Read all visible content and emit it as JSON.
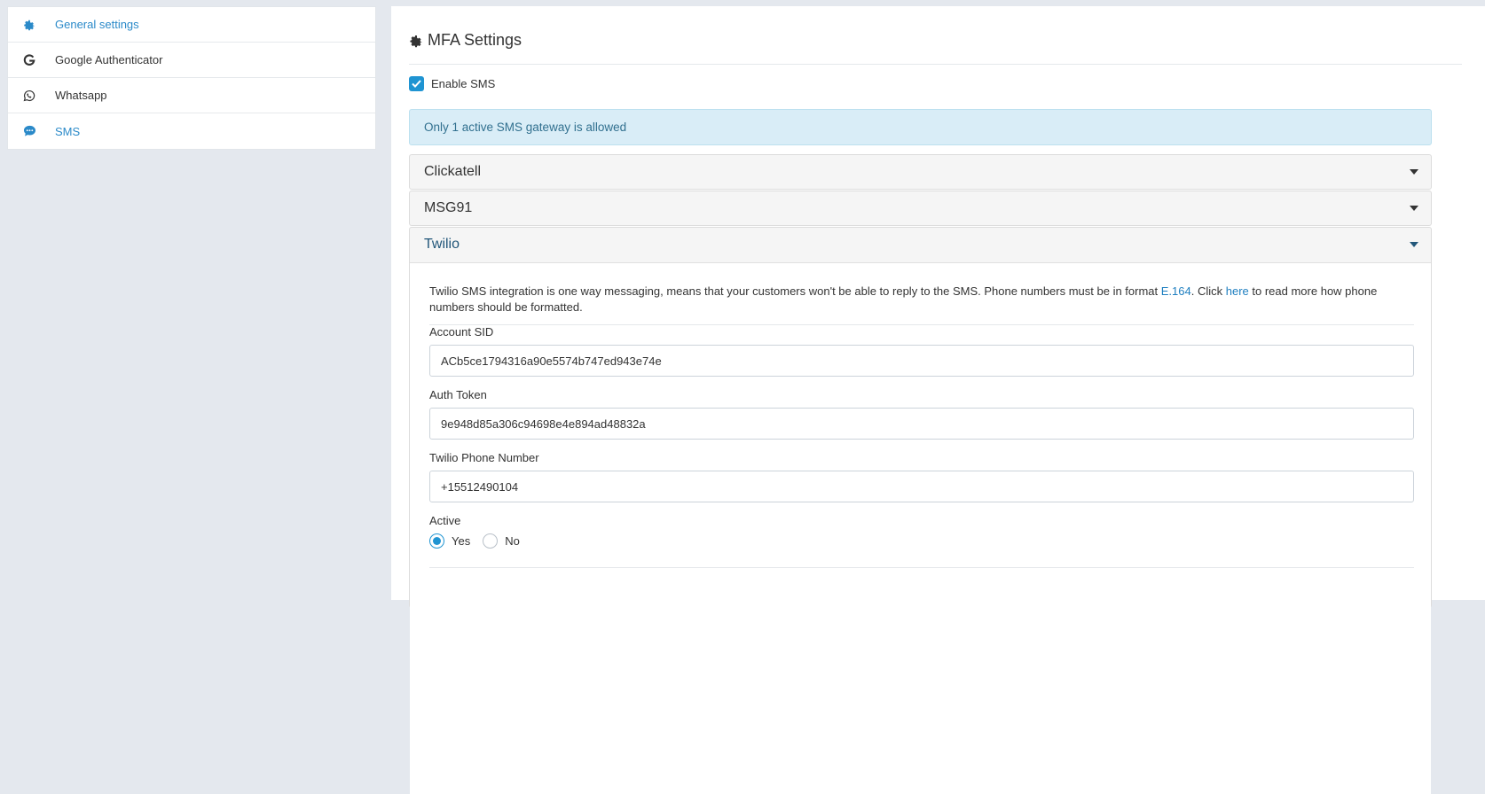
{
  "sidebar": {
    "items": [
      {
        "label": "General settings",
        "icon": "gear-icon"
      },
      {
        "label": "Google Authenticator",
        "icon": "google-icon"
      },
      {
        "label": "Whatsapp",
        "icon": "whatsapp-icon"
      },
      {
        "label": "SMS",
        "icon": "chat-icon"
      }
    ]
  },
  "main": {
    "title": "MFA Settings",
    "enable_sms_label": "Enable SMS",
    "enable_sms_checked": true,
    "alert": "Only 1 active SMS gateway is allowed",
    "gateways": [
      {
        "name": "Clickatell",
        "expanded": false
      },
      {
        "name": "MSG91",
        "expanded": false
      },
      {
        "name": "Twilio",
        "expanded": true
      }
    ],
    "twilio": {
      "desc_pre": "Twilio SMS integration is one way messaging, means that your customers won't be able to reply to the SMS. Phone numbers must be in format ",
      "desc_link1": "E.164",
      "desc_mid": ". Click ",
      "desc_link2": "here",
      "desc_post": " to read more how phone numbers should be formatted.",
      "account_sid_label": "Account SID",
      "account_sid_value": "ACb5ce1794316a90e5574b747ed943e74e",
      "auth_token_label": "Auth Token",
      "auth_token_value": "9e948d85a306c94698e4e894ad48832a",
      "phone_label": "Twilio Phone Number",
      "phone_value": "+15512490104",
      "active_label": "Active",
      "active_yes": "Yes",
      "active_no": "No",
      "active_selected": "Yes"
    }
  },
  "colors": {
    "accent": "#1f94d2",
    "link": "#1f7fc0",
    "active_sidebar": "#2b8ac9",
    "alert_bg": "#d9edf7",
    "alert_text": "#31708f",
    "page_bg": "#e4e8ee"
  }
}
